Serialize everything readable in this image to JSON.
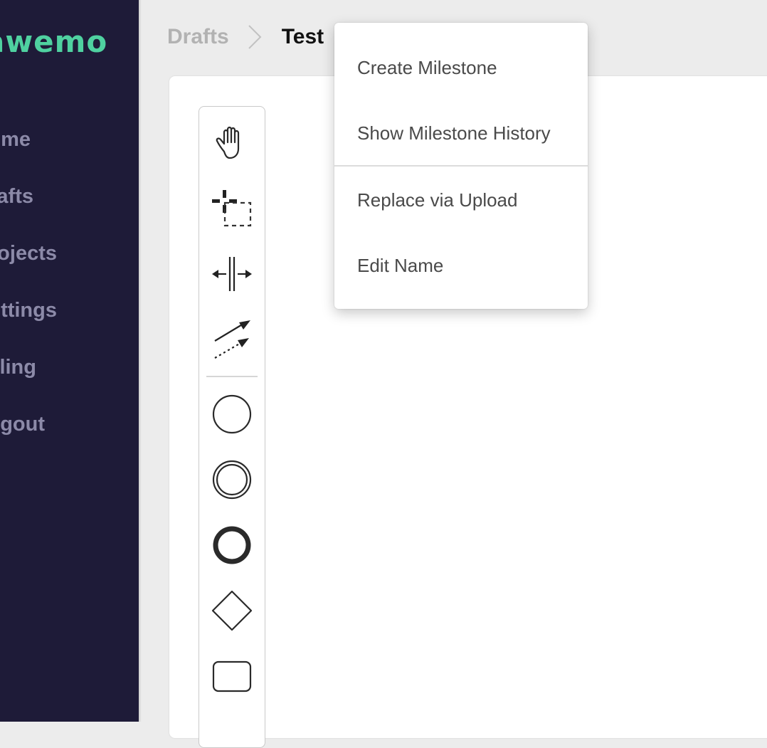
{
  "brand": {
    "logo_text": "awemo",
    "logo_color": "#4fd1a0"
  },
  "sidebar": {
    "background": "#1e1b38",
    "items": [
      {
        "label": "Home"
      },
      {
        "label": "Drafts"
      },
      {
        "label": "Projects"
      },
      {
        "label": "Settings"
      },
      {
        "label": "Billing"
      },
      {
        "label": "Logout"
      }
    ]
  },
  "breadcrumb": {
    "parent": "Drafts",
    "current": "Test"
  },
  "context_menu": {
    "items": [
      {
        "label": "Create Milestone"
      },
      {
        "label": "Show Milestone History"
      },
      {
        "label": "Replace via Upload"
      },
      {
        "label": "Edit Name"
      }
    ]
  },
  "palette": {
    "tools": [
      {
        "icon": "hand-tool-icon"
      },
      {
        "icon": "lasso-tool-icon"
      },
      {
        "icon": "space-tool-icon"
      },
      {
        "icon": "connect-tool-icon"
      },
      {
        "icon": "start-event-icon"
      },
      {
        "icon": "intermediate-event-icon"
      },
      {
        "icon": "end-event-icon"
      },
      {
        "icon": "gateway-icon"
      },
      {
        "icon": "task-icon"
      }
    ]
  }
}
